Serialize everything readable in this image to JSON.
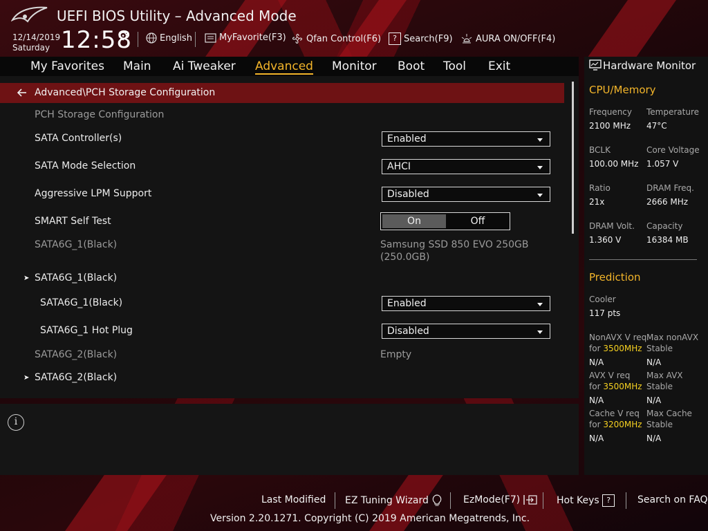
{
  "header": {
    "title": "UEFI BIOS Utility – Advanced Mode",
    "date": "12/14/2019",
    "day": "Saturday",
    "time": "12:58",
    "tools": {
      "language": "English",
      "myfavorite": "MyFavorite(F3)",
      "qfan": "Qfan Control(F6)",
      "search": "Search(F9)",
      "aura": "AURA ON/OFF(F4)"
    }
  },
  "menu": [
    "My Favorites",
    "Main",
    "Ai Tweaker",
    "Advanced",
    "Monitor",
    "Boot",
    "Tool",
    "Exit"
  ],
  "menu_active": "Advanced",
  "breadcrumb": "Advanced\\PCH Storage Configuration",
  "settings": {
    "section_title": "PCH Storage Configuration",
    "sata_controller": {
      "label": "SATA Controller(s)",
      "value": "Enabled"
    },
    "sata_mode": {
      "label": "SATA Mode Selection",
      "value": "AHCI"
    },
    "lpm": {
      "label": "Aggressive LPM Support",
      "value": "Disabled"
    },
    "smart": {
      "label": "SMART Self Test",
      "on": "On",
      "off": "Off",
      "selected": "On"
    },
    "port1_info": {
      "label": "SATA6G_1(Black)",
      "value_line1": "Samsung SSD 850 EVO 250GB",
      "value_line2": "(250.0GB)"
    },
    "port1_submenu": "SATA6G_1(Black)",
    "port1_enable": {
      "label": "SATA6G_1(Black)",
      "value": "Enabled"
    },
    "port1_hotplug": {
      "label": "SATA6G_1 Hot Plug",
      "value": "Disabled"
    },
    "port2_info": {
      "label": "SATA6G_2(Black)",
      "value": "Empty"
    },
    "port2_submenu": "SATA6G_2(Black)"
  },
  "hw_monitor": {
    "title": "Hardware Monitor",
    "cpu_memory": {
      "heading": "CPU/Memory",
      "frequency": {
        "label": "Frequency",
        "value": "2100 MHz"
      },
      "temperature": {
        "label": "Temperature",
        "value": "47°C"
      },
      "bclk": {
        "label": "BCLK",
        "value": "100.00 MHz"
      },
      "core_voltage": {
        "label": "Core Voltage",
        "value": "1.057 V"
      },
      "ratio": {
        "label": "Ratio",
        "value": "21x"
      },
      "dram_freq": {
        "label": "DRAM Freq.",
        "value": "2666 MHz"
      },
      "dram_volt": {
        "label": "DRAM Volt.",
        "value": "1.360 V"
      },
      "capacity": {
        "label": "Capacity",
        "value": "16384 MB"
      }
    },
    "prediction": {
      "heading": "Prediction",
      "cooler": {
        "label": "Cooler",
        "value": "117 pts"
      },
      "nonavx": {
        "label1": "NonAVX V req",
        "label2_prefix": "for",
        "freq": "3500MHz",
        "value": "N/A"
      },
      "max_nonavx": {
        "label1": "Max nonAVX",
        "label2": "Stable",
        "value": "N/A"
      },
      "avx": {
        "label1": "AVX V req",
        "label2_prefix": "for",
        "freq": "3500MHz",
        "value": "N/A"
      },
      "max_avx": {
        "label1": "Max AVX",
        "label2": "Stable",
        "value": "N/A"
      },
      "cache": {
        "label1": "Cache V req",
        "label2_prefix": "for",
        "freq": "3200MHz",
        "value": "N/A"
      },
      "max_cache": {
        "label1": "Max Cache",
        "label2": "Stable",
        "value": "N/A"
      }
    }
  },
  "footer": {
    "last_modified": "Last Modified",
    "ez_tuning": "EZ Tuning Wizard",
    "ezmode": "EzMode(F7)",
    "hotkeys": "Hot Keys",
    "hotkeys_key": "?",
    "search_faq": "Search on FAQ",
    "copyright": "Version 2.20.1271. Copyright (C) 2019 American Megatrends, Inc."
  },
  "colors": {
    "accent": "#f3b52a",
    "breadcrumb_bg": "#6e1214",
    "freq_highlight": "#f5d020"
  }
}
